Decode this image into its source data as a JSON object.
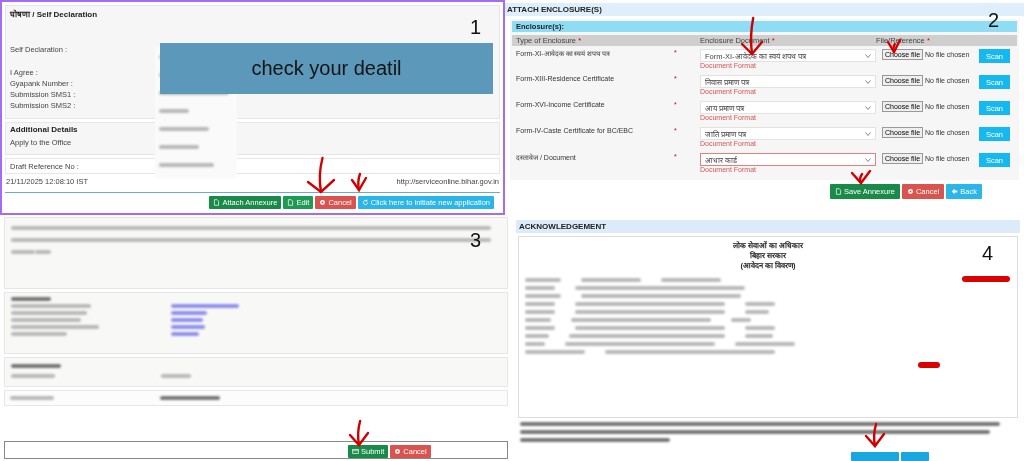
{
  "step1": {
    "number": "1",
    "title": "घोषणा / Self Declaration",
    "fields": [
      "Self Declaration :",
      "I Agree :",
      "Gyapank Number :",
      "Submission SMS1 :",
      "Submission SMS2 :"
    ],
    "banner": "check your deatil",
    "additional_title": "Additional Details",
    "additional_label": "Apply to the Office",
    "draft_label": "Draft Reference No :",
    "timestamp": "21/11/2025 12:08:10 IST",
    "url": "http://serviceonline.bihar.gov.in",
    "buttons": [
      {
        "label": "Attach Annexure",
        "kind": "attach"
      },
      {
        "label": "Edit",
        "kind": "edit"
      },
      {
        "label": "Cancel",
        "kind": "cancel"
      },
      {
        "label": "Click here to initiate new application",
        "kind": "new"
      }
    ]
  },
  "step2": {
    "number": "2",
    "title": "ATTACH ENCLOSURE(S)",
    "section": "Enclosure(s):",
    "columns": [
      {
        "label": "Type of Enclosure",
        "mark": "*"
      },
      {
        "label": "Enclosure Document",
        "mark": "*"
      },
      {
        "label": "File/Reference",
        "mark": "*"
      }
    ],
    "rows": [
      {
        "type": "Form-XI-आवेदक का स्वयं शपथ पत्र",
        "mark": "*",
        "document": "Form-XI-आवेदक का स्वयं शपथ पत्र",
        "format": "Document Format",
        "file_button": "Choose file",
        "file_status": "No file chosen",
        "scan": "Scan",
        "invalid": false
      },
      {
        "type": "Form-XIII-Residence Certificate",
        "mark": "*",
        "document": "निवास प्रमाण पत्र",
        "format": "Document Format",
        "file_button": "Choose file",
        "file_status": "No file chosen",
        "scan": "Scan",
        "invalid": false
      },
      {
        "type": "Form-XVI-Income Certificate",
        "mark": "*",
        "document": "आय प्रमाण पत्र",
        "format": "Document Format",
        "file_button": "Choose file",
        "file_status": "No file chosen",
        "scan": "Scan",
        "invalid": false
      },
      {
        "type": "Form-IV-Caste Certificate for BC/EBC",
        "mark": "*",
        "document": "जाति प्रमाण पत्र",
        "format": "Document Format",
        "file_button": "Choose file",
        "file_status": "No file chosen",
        "scan": "Scan",
        "invalid": false
      },
      {
        "type": "दस्तावेज / Document",
        "mark": "*",
        "document": "आधार कार्ड",
        "format": "Document Format",
        "file_button": "Choose file",
        "file_status": "No file chosen",
        "scan": "Scan",
        "invalid": true
      }
    ],
    "buttons": [
      {
        "label": "Save Annexure",
        "kind": "attach"
      },
      {
        "label": "Cancel",
        "kind": "cancel"
      },
      {
        "label": "Back",
        "kind": "back"
      }
    ]
  },
  "step3": {
    "number": "3",
    "buttons": [
      {
        "label": "Submit",
        "kind": "submit"
      },
      {
        "label": "Cancel",
        "kind": "cancel"
      }
    ]
  },
  "step4": {
    "number": "4",
    "title": "ACKNOWLEDGEMENT",
    "heading": [
      "लोक सेवाओं का अधिकार",
      "बिहार सरकार",
      "(आवेदन का विवरण)"
    ]
  }
}
